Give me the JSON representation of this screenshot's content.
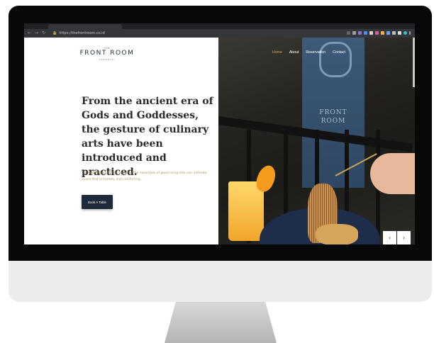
{
  "browser": {
    "tab_title": "",
    "url": "https://thefrontroom.co.id"
  },
  "site": {
    "logo_top": "THE",
    "logo": "FRONT ROOM",
    "logo_sub": "SENOPATI",
    "nav": [
      {
        "label": "Home",
        "active": true
      },
      {
        "label": "About"
      },
      {
        "label": "Reservation"
      },
      {
        "label": "Contact"
      }
    ],
    "headline": "From the ancient era of Gods and Goddesses, the gesture of culinary arts have been introduced and practiced.",
    "tagline": "The Front Room brings together the essentials of good living into one intimate space that is homely and comforting.",
    "cta_label": "Book A Table",
    "sign_text": "FRONT\nROOM"
  },
  "slider": {
    "prev_icon": "‹",
    "next_icon": "›"
  },
  "colors": {
    "navy": "#1d2b3a",
    "gold": "#b8935a",
    "nav_active": "#d8a850"
  }
}
